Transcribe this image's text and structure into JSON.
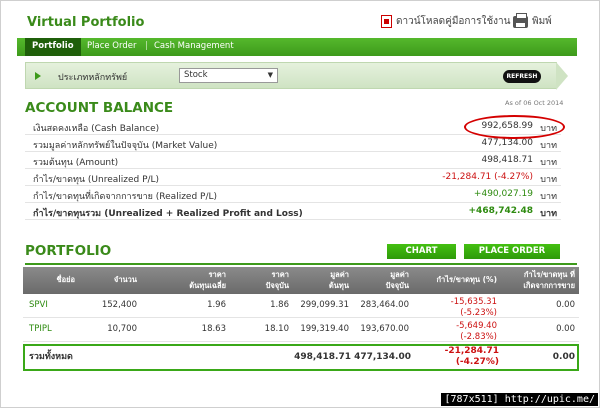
{
  "header": {
    "app_title": "Virtual Portfolio",
    "manual_link": "ดาวน์โหลดคู่มือการใช้งาน",
    "print_link": "พิมพ์"
  },
  "nav": {
    "tabs": [
      {
        "label": "Portfolio",
        "active": true
      },
      {
        "label": "Place Order",
        "active": false
      },
      {
        "label": "Cash Management",
        "active": false
      }
    ],
    "separator": "|"
  },
  "asset_filter": {
    "label": "ประเภทหลักทรัพย์",
    "selected": "Stock",
    "refresh_label": "REFRESH"
  },
  "account_balance": {
    "title": "ACCOUNT BALANCE",
    "as_of": "As of 06 Oct 2014",
    "unit": "บาท",
    "rows": [
      {
        "label": "เงินสดคงเหลือ (Cash Balance)",
        "value": "992,658.99",
        "tone": "normal"
      },
      {
        "label": "รวมมูลค่าหลักทรัพย์ในปัจจุบัน (Market Value)",
        "value": "477,134.00",
        "tone": "normal"
      },
      {
        "label": "รวมต้นทุน (Amount)",
        "value": "498,418.71",
        "tone": "normal"
      },
      {
        "label": "กำไร/ขาดทุน (Unrealized P/L)",
        "value": "-21,284.71 (-4.27%)",
        "tone": "negative"
      },
      {
        "label": "กำไร/ขาดทุนที่เกิดจากการขาย (Realized P/L)",
        "value": "+490,027.19",
        "tone": "positive"
      },
      {
        "label": "กำไร/ขาดทุนรวม (Unrealized + Realized Profit and Loss)",
        "value": "+468,742.48",
        "tone": "positive"
      }
    ]
  },
  "portfolio": {
    "title": "PORTFOLIO",
    "chart_button": "CHART",
    "place_order_button": "PLACE ORDER",
    "columns": [
      {
        "line1": "ชื่อย่อ",
        "line2": ""
      },
      {
        "line1": "จำนวน",
        "line2": ""
      },
      {
        "line1": "ราคา",
        "line2": "ต้นทุนเฉลี่ย"
      },
      {
        "line1": "ราคา",
        "line2": "ปัจจุบัน"
      },
      {
        "line1": "มูลค่า",
        "line2": "ต้นทุน"
      },
      {
        "line1": "มูลค่า",
        "line2": "ปัจจุบัน"
      },
      {
        "line1": "กำไร/ขาดทุน (%)",
        "line2": ""
      },
      {
        "line1": "กำไร/ขาดทุน ที่",
        "line2": "เกิดจากการขาย"
      }
    ],
    "rows": [
      {
        "symbol": "SPVI",
        "qty": "152,400",
        "avg_cost": "1.96",
        "price": "1.86",
        "cost_value": "299,099.31",
        "market_value": "283,464.00",
        "pl": "-15,635.31",
        "pl_pct": "(-5.23%)",
        "realized": "0.00"
      },
      {
        "symbol": "TPIPL",
        "qty": "10,700",
        "avg_cost": "18.63",
        "price": "18.10",
        "cost_value": "199,319.40",
        "market_value": "193,670.00",
        "pl": "-5,649.40",
        "pl_pct": "(-2.83%)",
        "realized": "0.00"
      }
    ],
    "total": {
      "label": "รวมทั้งหมด",
      "cost_value": "498,418.71",
      "market_value": "477,134.00",
      "pl": "-21,284.71",
      "pl_pct": "(-4.27%)",
      "realized": "0.00"
    }
  },
  "watermark": "[787x511] http://upic.me/",
  "colors": {
    "accent_green": "#3a8a1a",
    "negative_red": "#cc1111",
    "highlight_red": "#d40000"
  }
}
